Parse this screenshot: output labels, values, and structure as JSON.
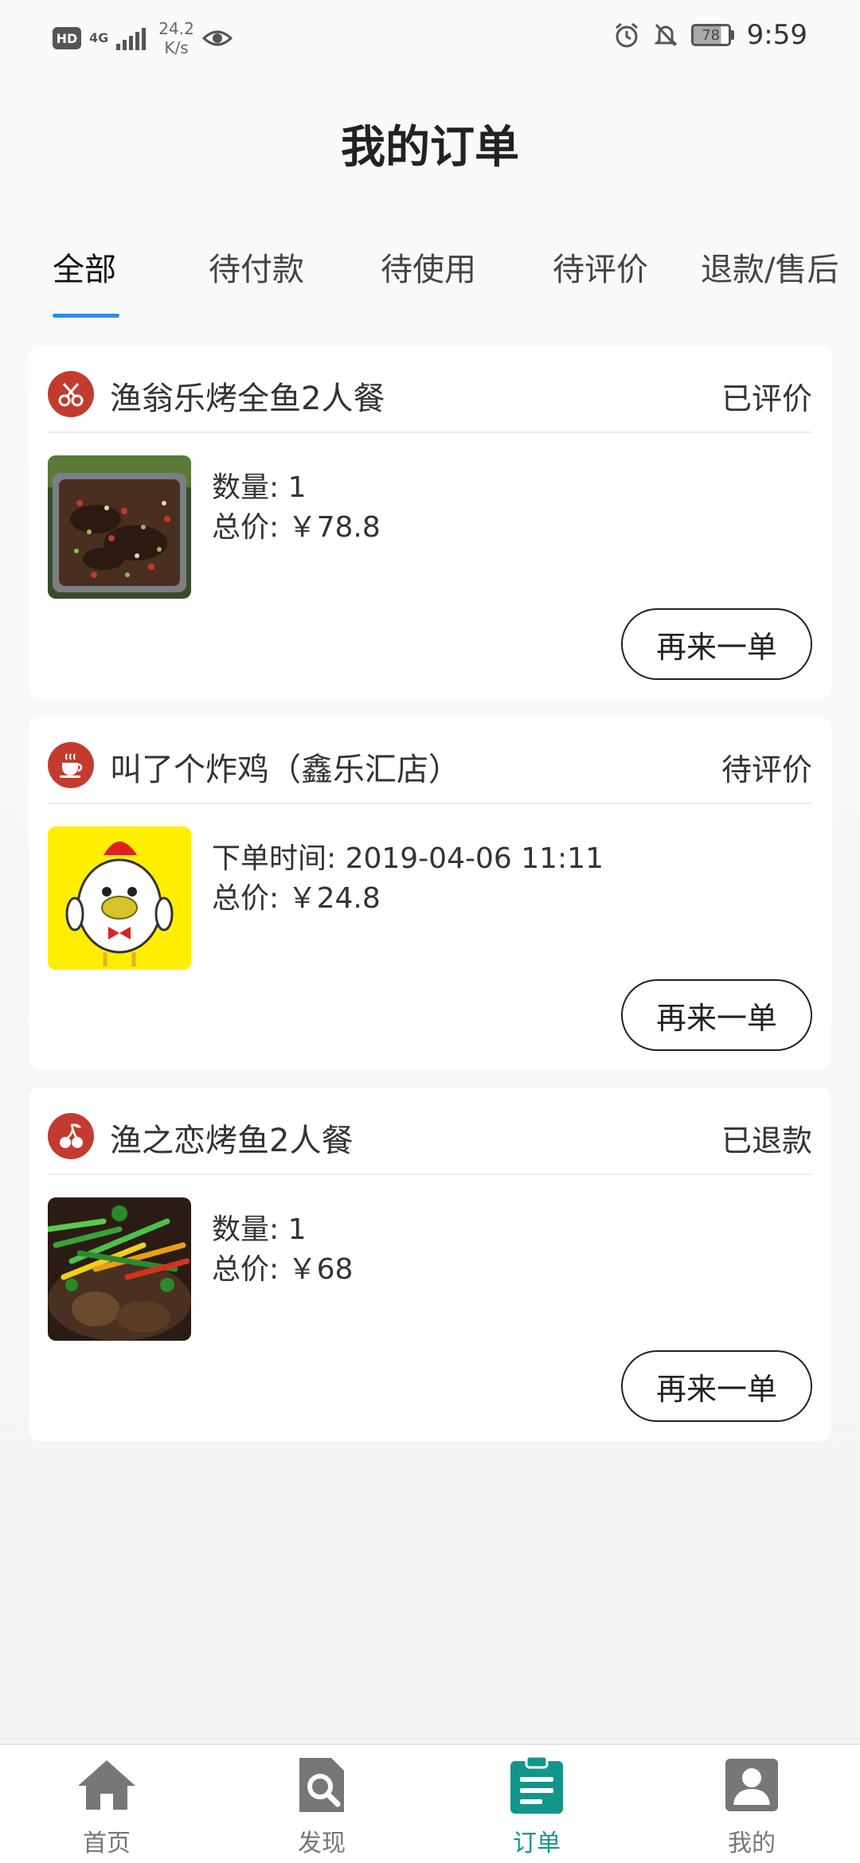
{
  "status_bar": {
    "hd": "HD",
    "network": "4G",
    "speed_value": "24.2",
    "speed_unit": "K/s",
    "battery": "78",
    "time": "9:59"
  },
  "header": {
    "title": "我的订单"
  },
  "tabs": [
    {
      "label": "全部",
      "active": true
    },
    {
      "label": "待付款",
      "active": false
    },
    {
      "label": "待使用",
      "active": false
    },
    {
      "label": "待评价",
      "active": false
    },
    {
      "label": "退款/售后",
      "active": false
    }
  ],
  "orders": [
    {
      "shop_icon": "scissors-icon",
      "shop_name": "渔翁乐烤全鱼2人餐",
      "status": "已评价",
      "line1": "数量: 1",
      "line2": "总价: ￥78.8",
      "button": "再来一单"
    },
    {
      "shop_icon": "coffee-cup-icon",
      "shop_name": "叫了个炸鸡（鑫乐汇店）",
      "status": "待评价",
      "line1": "下单时间: 2019-04-06 11:11",
      "line2": "总价: ￥24.8",
      "button": "再来一单"
    },
    {
      "shop_icon": "cherry-icon",
      "shop_name": "渔之恋烤鱼2人餐",
      "status": "已退款",
      "line1": "数量: 1",
      "line2": "总价: ￥68",
      "button": "再来一单"
    }
  ],
  "bottom_nav": [
    {
      "label": "首页",
      "icon": "home-icon",
      "active": false
    },
    {
      "label": "发现",
      "icon": "discover-search-icon",
      "active": false
    },
    {
      "label": "订单",
      "icon": "orders-clipboard-icon",
      "active": true
    },
    {
      "label": "我的",
      "icon": "profile-icon",
      "active": false
    }
  ],
  "colors": {
    "accent": "#2a8ee8",
    "nav_active": "#12958a",
    "shop_icon_bg": "#c43a2f"
  }
}
